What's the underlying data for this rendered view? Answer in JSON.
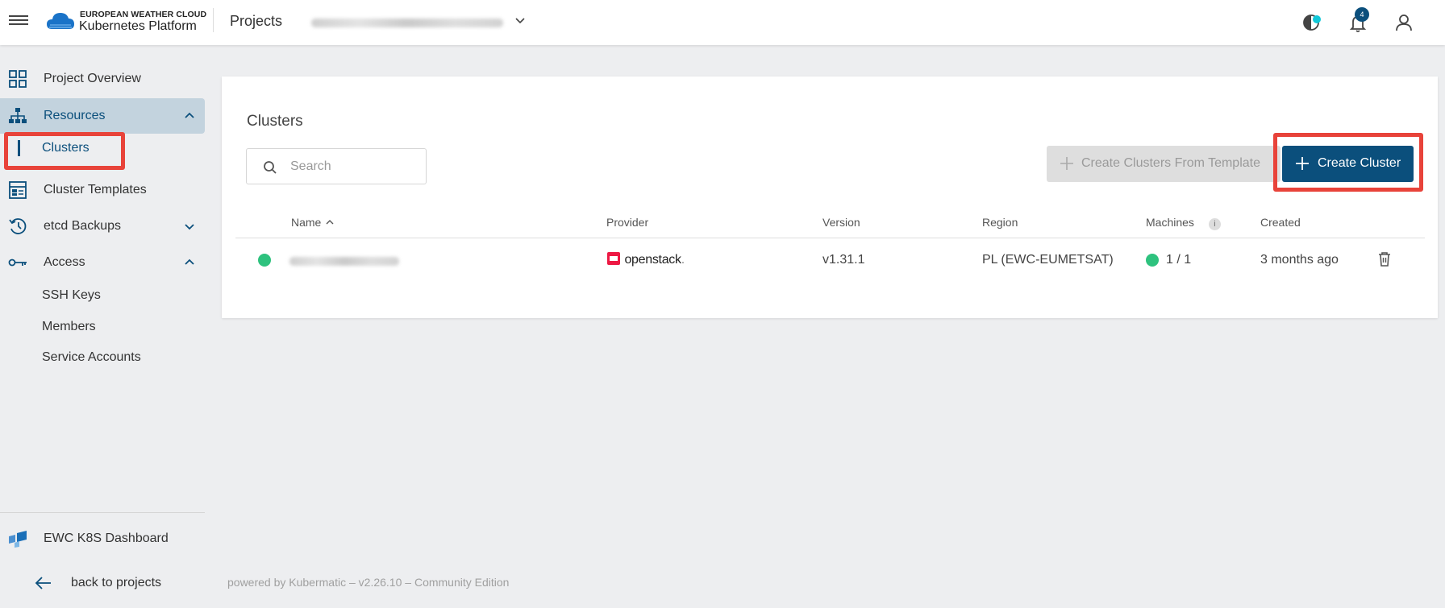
{
  "topbar": {
    "brand_small": "EUROPEAN WEATHER CLOUD",
    "brand_big": "Kubernetes Platform",
    "section": "Projects",
    "notification_count": "4",
    "icons": [
      "menu-icon",
      "cloud-logo-icon",
      "chevron-down-icon",
      "theme-toggle-icon",
      "bell-icon",
      "user-icon"
    ]
  },
  "sidebar": {
    "project_overview": "Project Overview",
    "resources": "Resources",
    "clusters": "Clusters",
    "cluster_templates": "Cluster Templates",
    "etcd_backups": "etcd Backups",
    "access": "Access",
    "ssh_keys": "SSH Keys",
    "members": "Members",
    "service_accounts": "Service Accounts",
    "dashboard": "EWC K8S Dashboard",
    "back": "back to projects"
  },
  "main": {
    "title": "Clusters",
    "search_placeholder": "Search",
    "btn_template": "Create Clusters From Template",
    "btn_create": "Create Cluster",
    "columns": {
      "name": "Name",
      "provider": "Provider",
      "version": "Version",
      "region": "Region",
      "machines": "Machines",
      "created": "Created"
    },
    "rows": [
      {
        "provider": "openstack",
        "version": "v1.31.1",
        "region": "PL (EWC-EUMETSAT)",
        "machines": "1 / 1",
        "created": "3 months ago"
      }
    ]
  },
  "footer": {
    "powered": "powered by Kubermatic",
    "version": "v2.26.10",
    "edition": "Community Edition"
  },
  "colors": {
    "accent": "#0b4f7c",
    "active_bg": "#c3d3de",
    "status_ok": "#2ec27e",
    "highlight": "#e8433a"
  }
}
